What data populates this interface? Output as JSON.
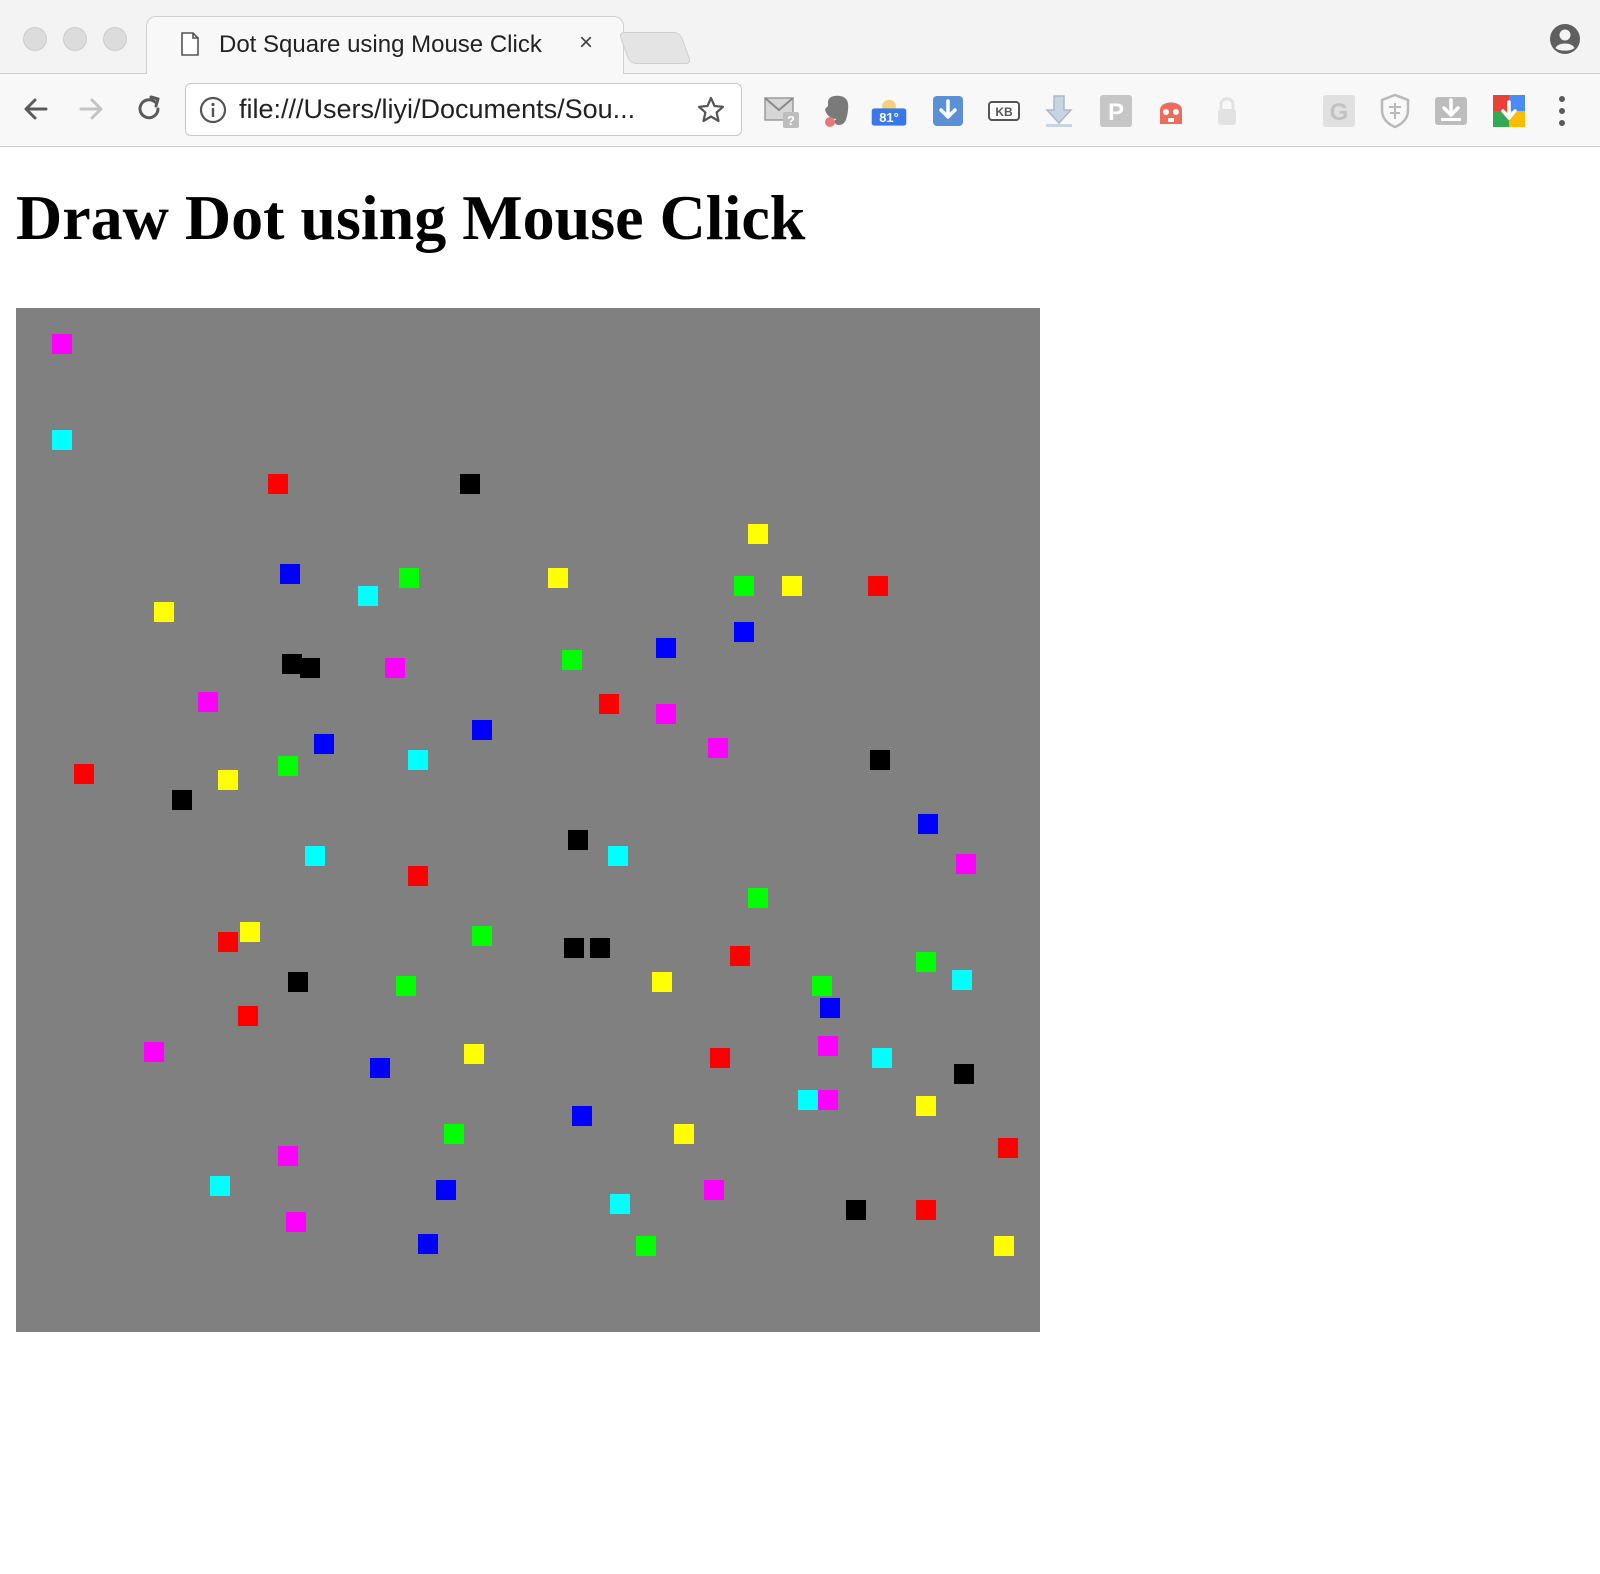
{
  "browser": {
    "tab_title": "Dot Square using Mouse Click",
    "tab_close": "×",
    "url": "file:///Users/liyi/Documents/Sou...",
    "weather_badge": "81°",
    "kb_extension_label": "KB",
    "p_extension_label": "P",
    "g_extension_label": "G"
  },
  "page": {
    "heading": "Draw Dot using Mouse Click"
  },
  "canvas": {
    "background": "#808080",
    "dots": [
      {
        "color": "#ff00ff"
      },
      {
        "color": "#00ffff"
      },
      {
        "color": "#ff0000"
      },
      {
        "color": "#000000"
      },
      {
        "color": "#ffff00"
      },
      {
        "color": "#0000ff"
      },
      {
        "color": "#00ffff"
      },
      {
        "color": "#00ff00"
      },
      {
        "color": "#ffff00"
      },
      {
        "color": "#00ff00"
      },
      {
        "color": "#ffff00"
      },
      {
        "color": "#ff0000"
      },
      {
        "color": "#ffff00"
      },
      {
        "color": "#0000ff"
      },
      {
        "color": "#0000ff"
      },
      {
        "color": "#000000"
      },
      {
        "color": "#000000"
      },
      {
        "color": "#ff00ff"
      },
      {
        "color": "#00ff00"
      },
      {
        "color": "#ff00ff"
      },
      {
        "color": "#ff0000"
      },
      {
        "color": "#ff00ff"
      },
      {
        "color": "#0000ff"
      },
      {
        "color": "#0000ff"
      },
      {
        "color": "#ff00ff"
      },
      {
        "color": "#ff0000"
      },
      {
        "color": "#ffff00"
      },
      {
        "color": "#00ff00"
      },
      {
        "color": "#00ffff"
      },
      {
        "color": "#000000"
      },
      {
        "color": "#000000"
      },
      {
        "color": "#0000ff"
      },
      {
        "color": "#000000"
      },
      {
        "color": "#00ffff"
      },
      {
        "color": "#00ffff"
      },
      {
        "color": "#ff0000"
      },
      {
        "color": "#ff00ff"
      },
      {
        "color": "#00ff00"
      },
      {
        "color": "#ffff00"
      },
      {
        "color": "#ff0000"
      },
      {
        "color": "#00ff00"
      },
      {
        "color": "#000000"
      },
      {
        "color": "#000000"
      },
      {
        "color": "#ff0000"
      },
      {
        "color": "#000000"
      },
      {
        "color": "#00ff00"
      },
      {
        "color": "#ffff00"
      },
      {
        "color": "#00ff00"
      },
      {
        "color": "#00ff00"
      },
      {
        "color": "#00ffff"
      },
      {
        "color": "#0000ff"
      },
      {
        "color": "#ff0000"
      },
      {
        "color": "#ff00ff"
      },
      {
        "color": "#ff00ff"
      },
      {
        "color": "#0000ff"
      },
      {
        "color": "#ffff00"
      },
      {
        "color": "#ff0000"
      },
      {
        "color": "#ff00ff"
      },
      {
        "color": "#00ffff"
      },
      {
        "color": "#000000"
      },
      {
        "color": "#00ffff"
      },
      {
        "color": "#ffff00"
      },
      {
        "color": "#0000ff"
      },
      {
        "color": "#00ff00"
      },
      {
        "color": "#ffff00"
      },
      {
        "color": "#ff0000"
      },
      {
        "color": "#ff00ff"
      },
      {
        "color": "#00ffff"
      },
      {
        "color": "#0000ff"
      },
      {
        "color": "#ff00ff"
      },
      {
        "color": "#00ffff"
      },
      {
        "color": "#ff00ff"
      },
      {
        "color": "#000000"
      },
      {
        "color": "#ff0000"
      },
      {
        "color": "#0000ff"
      },
      {
        "color": "#00ff00"
      },
      {
        "color": "#ffff00"
      }
    ]
  }
}
